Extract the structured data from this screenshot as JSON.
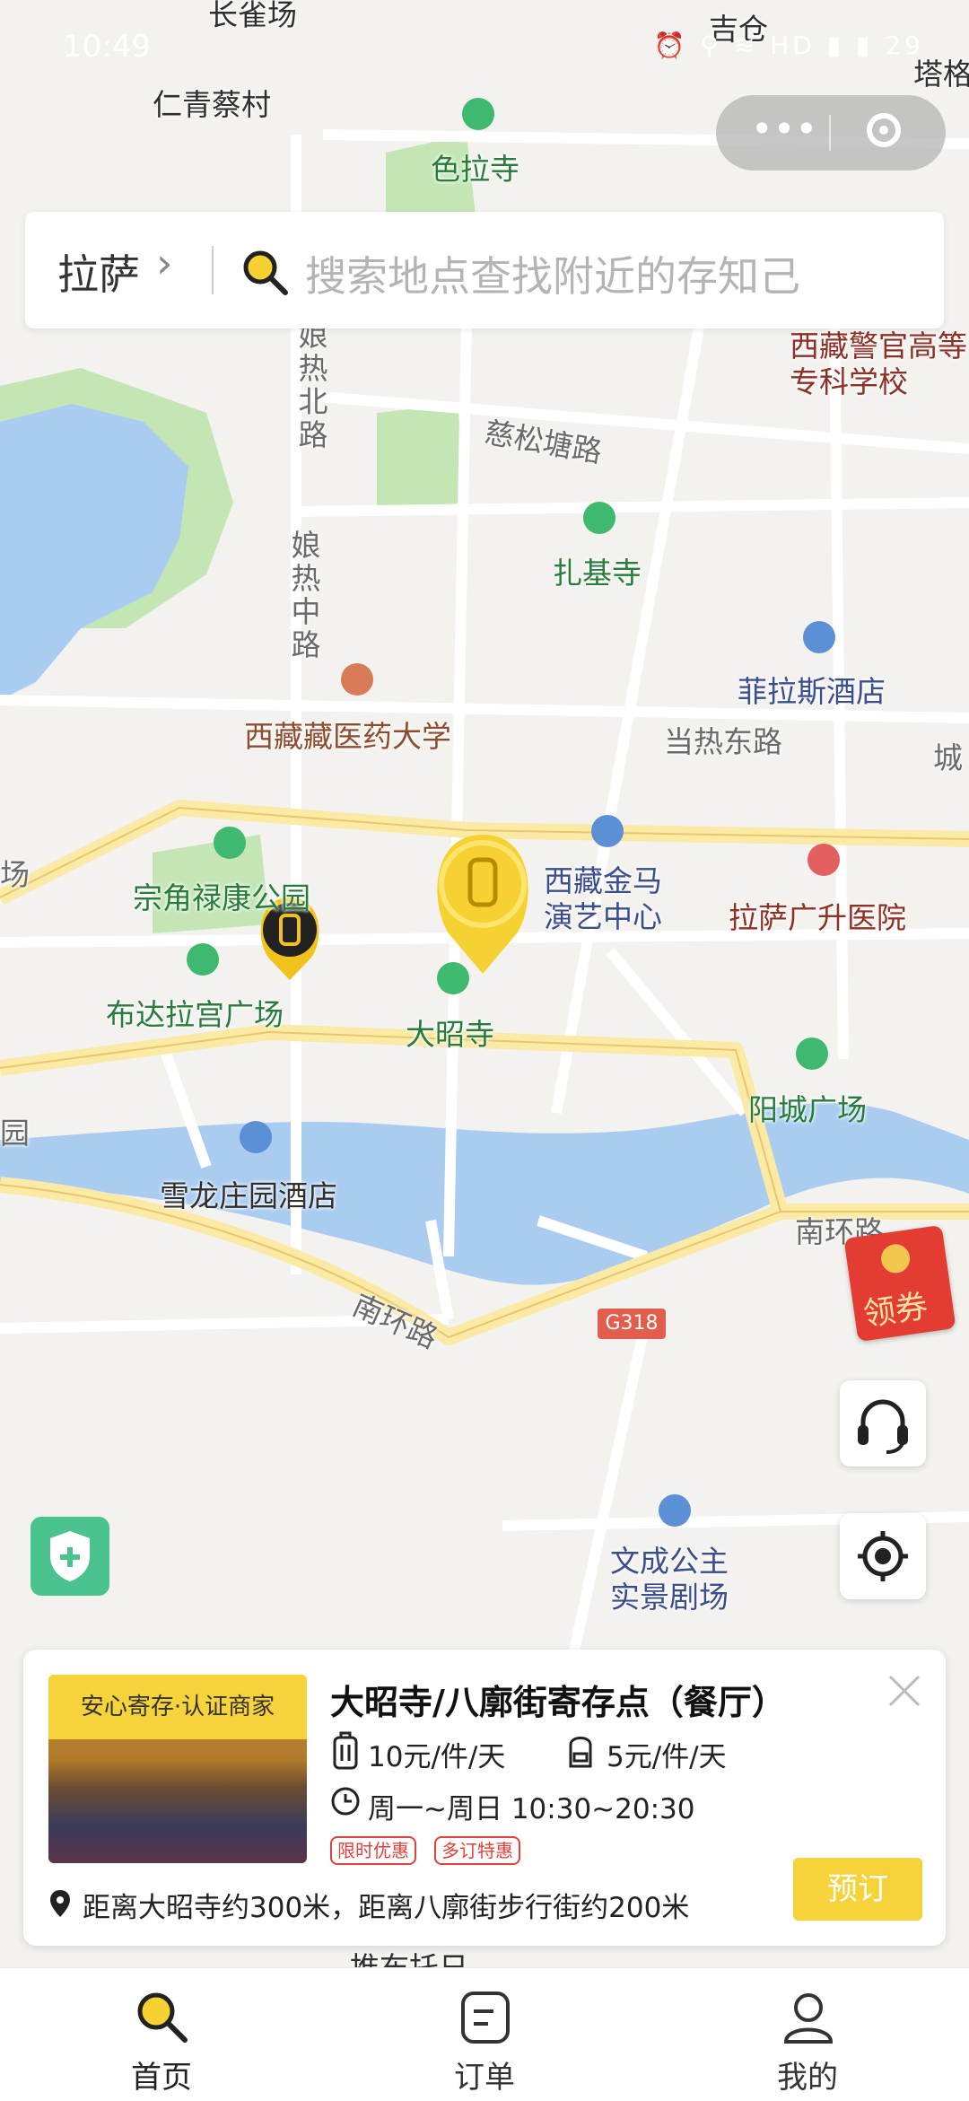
{
  "status_bar": {
    "time": "10:49",
    "icons": "⏰ ⚲ ≋ HD ▮ ▮ 29"
  },
  "capsule": {
    "more_icon": "more-dots-icon",
    "close_icon": "target-circle-icon"
  },
  "search": {
    "city": "拉萨",
    "placeholder": "搜索地点查找附近的存知己"
  },
  "map_labels": {
    "top1": "长雀场",
    "top2": "吉仓",
    "top3": "塔格",
    "renqing": "仁青蔡村",
    "sela": "色拉寺",
    "tibetan_police": "西藏警官高等\n专科学校",
    "niangre_north": "娘热北路",
    "cisong": "慈松塘路",
    "zhaji": "扎基寺",
    "niangre_mid": "娘热中路",
    "feilasi": "菲拉斯酒店",
    "zangyi": "西藏藏医药大学",
    "dangre": "当热东路",
    "cheng": "城",
    "chang": "场",
    "zongjiao": "宗角禄康公园",
    "jinma": "西藏金马\n演艺中心",
    "hospital": "拉萨广升医院",
    "potala_square": "布达拉宫广场",
    "dazhao": "大昭寺",
    "yangcheng": "阳城广场",
    "xuelong": "雪龙庄园酒店",
    "nanhuan1": "南环路",
    "nanhuan2": "南环路",
    "g318": "G318",
    "wencheng": "文成公主\n实景剧场",
    "bottom": "推布托日",
    "left_edge": "园"
  },
  "coupon": {
    "label": "领券"
  },
  "card": {
    "tag": "安心寄存·认证商家",
    "title": "大昭寺/八廓街寄存点（餐厅）",
    "price_luggage": "10元/件/天",
    "price_bag": "5元/件/天",
    "hours": "周一~周日 10:30~20:30",
    "badges": [
      "限时优惠",
      "多订特惠"
    ],
    "distance": "距离大昭寺约300米，距离八廓街步行街约200米",
    "book": "预订"
  },
  "tabs": [
    {
      "label": "首页",
      "icon": "search-icon",
      "active": true
    },
    {
      "label": "订单",
      "icon": "order-list-icon",
      "active": false
    },
    {
      "label": "我的",
      "icon": "profile-icon",
      "active": false
    }
  ],
  "colors": {
    "accent": "#f6d33b",
    "water": "#a9ccf0",
    "park": "#c4e6b4",
    "road_major": "#fbe9a6"
  }
}
